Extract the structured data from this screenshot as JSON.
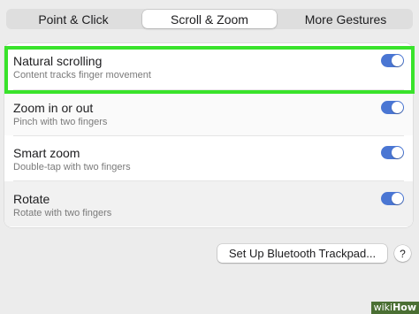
{
  "colors": {
    "toggle_on": "#4a76d3",
    "highlight": "#39e32b",
    "window_bg": "#ececec",
    "watermark_bg": "#4a6f33"
  },
  "tabs": [
    {
      "label": "Point & Click",
      "active": false
    },
    {
      "label": "Scroll & Zoom",
      "active": true
    },
    {
      "label": "More Gestures",
      "active": false
    }
  ],
  "settings": [
    {
      "title": "Natural scrolling",
      "subtitle": "Content tracks finger movement",
      "enabled": true,
      "icon": "toggle-switch-icon"
    },
    {
      "title": "Zoom in or out",
      "subtitle": "Pinch with two fingers",
      "enabled": true,
      "icon": "toggle-switch-icon"
    },
    {
      "title": "Smart zoom",
      "subtitle": "Double-tap with two fingers",
      "enabled": true,
      "icon": "toggle-switch-icon"
    },
    {
      "title": "Rotate",
      "subtitle": "Rotate with two fingers",
      "enabled": true,
      "icon": "toggle-switch-icon"
    }
  ],
  "buttons": {
    "bluetooth_label": "Set Up Bluetooth Trackpad...",
    "help_label": "?"
  },
  "watermark": {
    "prefix": "wiki",
    "suffix": "How"
  }
}
